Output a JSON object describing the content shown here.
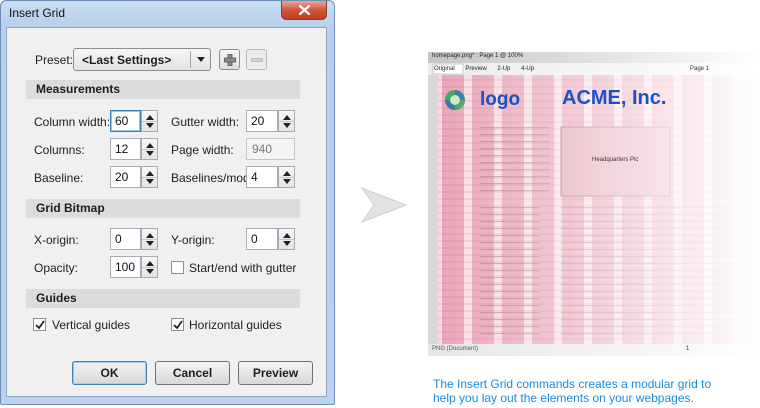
{
  "dialog": {
    "title": "Insert Grid",
    "preset_label": "Preset:",
    "preset_value": "<Last Settings>",
    "sections": {
      "measurements": "Measurements",
      "grid_bitmap": "Grid Bitmap",
      "guides": "Guides"
    },
    "fields": {
      "column_width": {
        "label": "Column width:",
        "value": "60"
      },
      "gutter_width": {
        "label": "Gutter width:",
        "value": "20"
      },
      "columns": {
        "label": "Columns:",
        "value": "12"
      },
      "page_width": {
        "label": "Page width:",
        "value": "940"
      },
      "baseline": {
        "label": "Baseline:",
        "value": "20"
      },
      "baselines_mod": {
        "label": "Baselines/mod:",
        "value": "4"
      },
      "x_origin": {
        "label": "X-origin:",
        "value": "0"
      },
      "y_origin": {
        "label": "Y-origin:",
        "value": "0"
      },
      "opacity": {
        "label": "Opacity:",
        "value": "100"
      }
    },
    "checkboxes": {
      "start_end_gutter": {
        "label": "Start/end with gutter",
        "checked": false
      },
      "vertical_guides": {
        "label": "Vertical guides",
        "checked": true
      },
      "horizontal_guides": {
        "label": "Horizontal guides",
        "checked": true
      }
    },
    "buttons": {
      "ok": "OK",
      "cancel": "Cancel",
      "preview": "Preview"
    }
  },
  "preview": {
    "doc_title": "homepage.png* : Page 1 @ 100%",
    "tabs": [
      "Original",
      "Preview",
      "2-Up",
      "4-Up"
    ],
    "page_indicator": "Page 1",
    "logo_text": "logo",
    "company_name": "ACME, Inc.",
    "image_placeholder": "Headquarters Pic",
    "status_left": "PNG (Document)",
    "page_number": "1",
    "colors": {
      "grid_column": "#e9a3b6",
      "grid_gutter": "#f7dbe3",
      "baseline_line": "#c0566f",
      "accent": "#1a52c4"
    }
  },
  "caption": {
    "line1": "The Insert Grid commands creates a modular grid to",
    "line2": "help you lay out the elements on your webpages."
  }
}
